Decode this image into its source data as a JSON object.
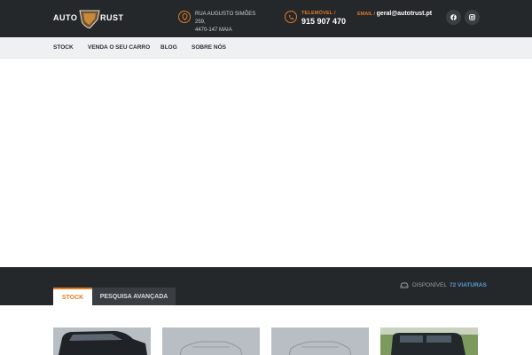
{
  "brand": {
    "word_left": "AUTO",
    "word_right": "RUST"
  },
  "header": {
    "address_line1": "RUA AUGUSTO SIMÕES 259,",
    "address_line2": "4470-147 MAIA",
    "phone_label": "TELEMÓVEL",
    "phone_sep": " /",
    "phone_number": "915 907 470",
    "email_label": "EMAIL",
    "email_sep": " / ",
    "email_value": "geral@autotrust.pt",
    "icons": [
      "location-pin-icon",
      "phone-icon",
      "facebook-icon",
      "instagram-icon"
    ]
  },
  "nav": {
    "items": [
      {
        "label": "STOCK"
      },
      {
        "label": "VENDA O SEU CARRO"
      },
      {
        "label": "BLOG"
      },
      {
        "label": "SOBRE NÓS"
      }
    ]
  },
  "search": {
    "tabs": [
      {
        "label": "STOCK"
      },
      {
        "label": "PESQUISA AVANÇADA"
      }
    ],
    "available_label": "DISPONÍVEL",
    "available_count": "72 VIATURAS"
  },
  "colors": {
    "accent": "#e07b24",
    "dark": "#25282b",
    "link": "#5b9bd5"
  }
}
